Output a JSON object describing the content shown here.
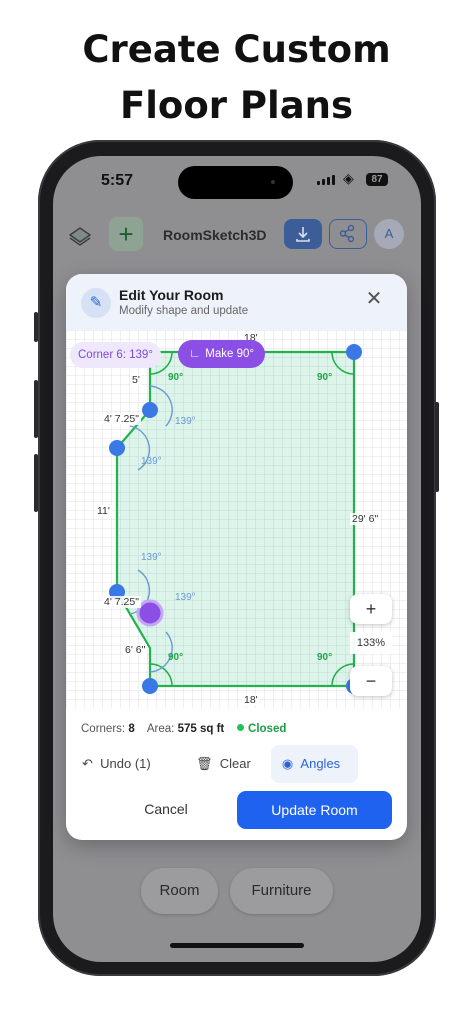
{
  "headline": {
    "line1": "Create Custom",
    "line2": "Floor Plans"
  },
  "status_bar": {
    "time": "5:57",
    "battery": "87"
  },
  "app_bar": {
    "title": "RoomSketch3D",
    "avatar": "A"
  },
  "modal": {
    "title": "Edit Your Room",
    "subtitle": "Modify shape and update",
    "corner_pill": "Corner 6: 139°",
    "make90_label": "Make 90°",
    "zoom_level": "133%",
    "dimensions": {
      "top": "18'",
      "bottom": "18'",
      "right": "29' 6\"",
      "left_top": "5'",
      "diag_top": "4' 7.25\"",
      "left_mid": "11'",
      "diag_bottom": "4' 7.25\"",
      "left_bottom": "6' 6\""
    },
    "angles": {
      "right": "90°",
      "obtuse": "139°"
    },
    "stats": {
      "corners_label": "Corners:",
      "corners": "8",
      "area_label": "Area:",
      "area": "575 sq ft",
      "status": "Closed"
    },
    "tools": {
      "undo": "Undo (1)",
      "clear": "Clear",
      "angles": "Angles"
    },
    "cancel": "Cancel",
    "update": "Update Room"
  },
  "bottom_tabs": {
    "room": "Room",
    "furniture": "Furniture"
  },
  "colors": {
    "accent": "#1f62f0",
    "wall": "#22b14c",
    "selected_corner": "#8b4fe6",
    "corner": "#3a78e6"
  }
}
